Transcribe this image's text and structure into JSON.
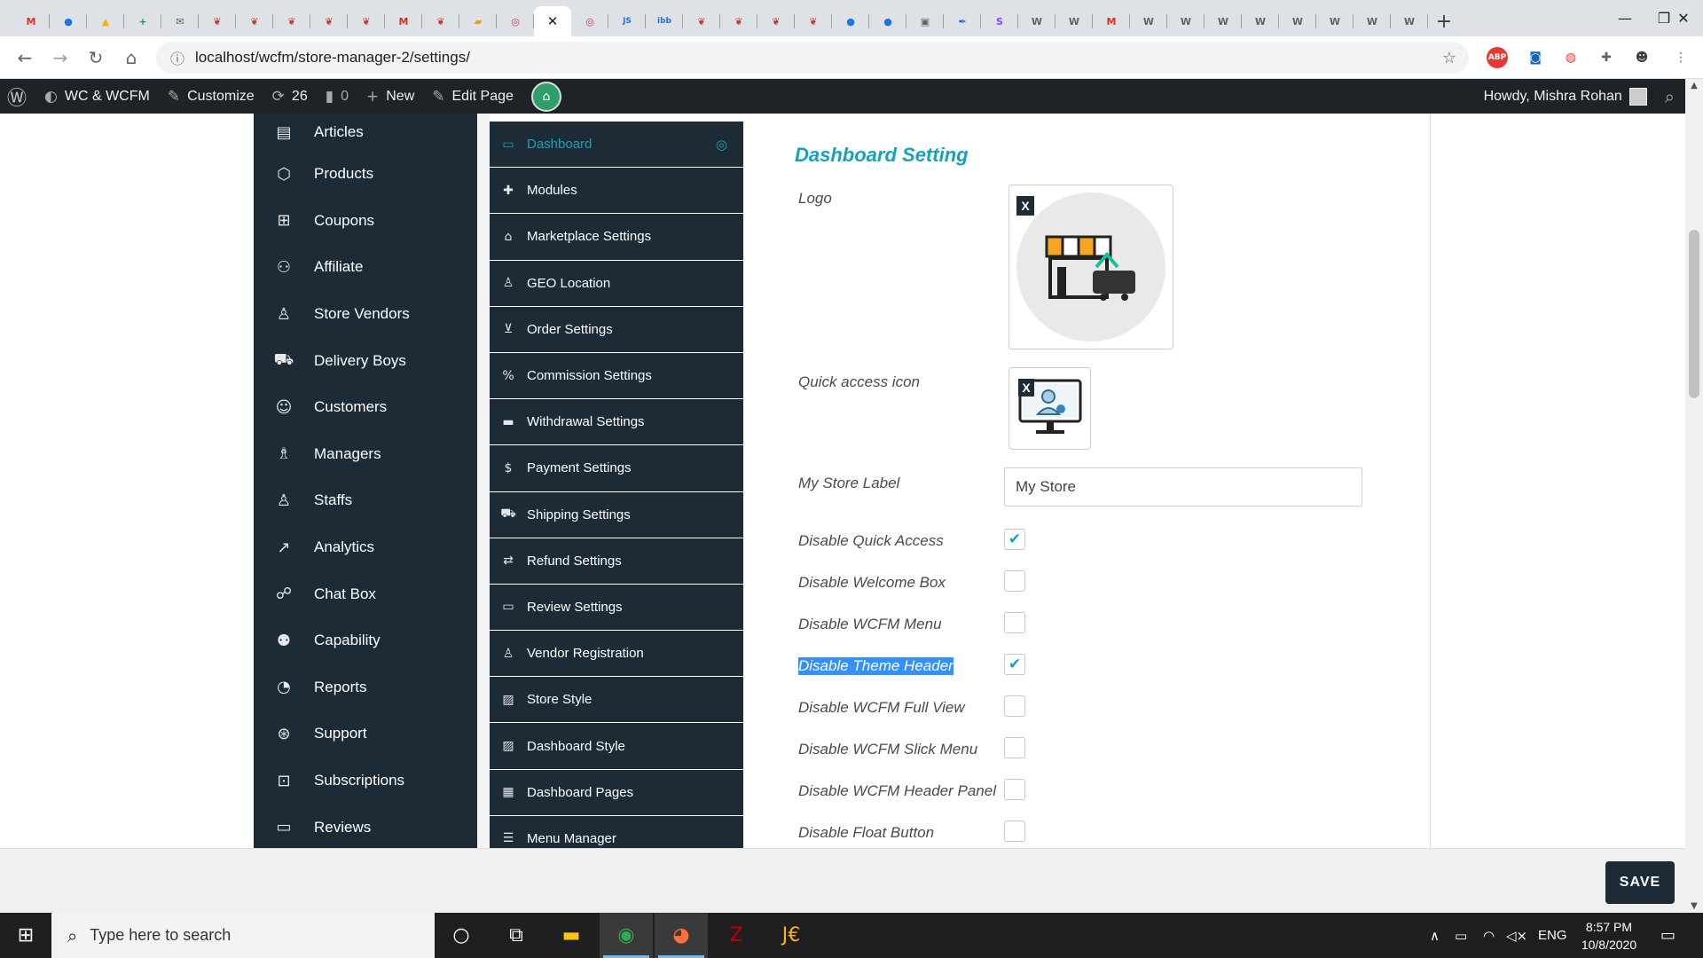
{
  "browser": {
    "tabs": [
      {
        "icon": "gmail-icon",
        "glyph": "M",
        "color": "#d93025"
      },
      {
        "icon": "globe-icon",
        "glyph": "●",
        "color": "#1a73e8"
      },
      {
        "icon": "google-drive-icon",
        "glyph": "▲",
        "color": "#f4b400"
      },
      {
        "icon": "sheets-icon",
        "glyph": "+",
        "color": "#0f9d58"
      },
      {
        "icon": "mail-icon",
        "glyph": "✉",
        "color": "#5f6368"
      },
      {
        "icon": "leaf-icon",
        "glyph": "❦",
        "color": "#c0392b"
      },
      {
        "icon": "leaf-icon",
        "glyph": "❦",
        "color": "#c0392b"
      },
      {
        "icon": "leaf-icon",
        "glyph": "❦",
        "color": "#c0392b"
      },
      {
        "icon": "leaf-icon",
        "glyph": "❦",
        "color": "#c0392b"
      },
      {
        "icon": "leaf-icon",
        "glyph": "❦",
        "color": "#c0392b"
      },
      {
        "icon": "gmail-icon",
        "glyph": "M",
        "color": "#d93025"
      },
      {
        "icon": "leaf-icon",
        "glyph": "❦",
        "color": "#c0392b"
      },
      {
        "icon": "pma-icon",
        "glyph": "▰",
        "color": "#f39c12"
      },
      {
        "icon": "instagram-icon",
        "glyph": "◎",
        "color": "#e1306c"
      },
      {
        "icon": "close-icon",
        "glyph": "✕",
        "color": "#202124",
        "active": true
      },
      {
        "icon": "instagram-icon",
        "glyph": "◎",
        "color": "#e1306c"
      },
      {
        "icon": "js-icon",
        "glyph": "JS",
        "color": "#1a73e8"
      },
      {
        "icon": "imgbb-icon",
        "glyph": "ibb",
        "color": "#1a73e8"
      },
      {
        "icon": "leaf-icon",
        "glyph": "❦",
        "color": "#c0392b"
      },
      {
        "icon": "leaf-icon",
        "glyph": "❦",
        "color": "#c0392b"
      },
      {
        "icon": "leaf-icon",
        "glyph": "❦",
        "color": "#c0392b"
      },
      {
        "icon": "leaf-icon",
        "glyph": "❦",
        "color": "#c0392b"
      },
      {
        "icon": "globe-icon",
        "glyph": "●",
        "color": "#1a73e8"
      },
      {
        "icon": "globe-icon",
        "glyph": "●",
        "color": "#1a73e8"
      },
      {
        "icon": "monitor-icon",
        "glyph": "▣",
        "color": "#5f6368"
      },
      {
        "icon": "feather-icon",
        "glyph": "✒",
        "color": "#1a73e8"
      },
      {
        "icon": "s-icon",
        "glyph": "S",
        "color": "#7c4dff"
      },
      {
        "icon": "wordpress-icon",
        "glyph": "W",
        "color": "#5f6368"
      },
      {
        "icon": "wordpress-icon",
        "glyph": "W",
        "color": "#5f6368"
      },
      {
        "icon": "gmail-icon",
        "glyph": "M",
        "color": "#d93025"
      },
      {
        "icon": "wordpress-icon",
        "glyph": "W",
        "color": "#5f6368"
      },
      {
        "icon": "wordpress-icon",
        "glyph": "W",
        "color": "#5f6368"
      },
      {
        "icon": "wordpress-icon",
        "glyph": "W",
        "color": "#5f6368"
      },
      {
        "icon": "wordpress-icon",
        "glyph": "W",
        "color": "#5f6368"
      },
      {
        "icon": "wordpress-icon",
        "glyph": "W",
        "color": "#5f6368"
      },
      {
        "icon": "wordpress-icon",
        "glyph": "W",
        "color": "#5f6368"
      },
      {
        "icon": "wordpress-icon",
        "glyph": "W",
        "color": "#5f6368"
      },
      {
        "icon": "wordpress-icon",
        "glyph": "W",
        "color": "#5f6368"
      }
    ],
    "new_tab_glyph": "+",
    "url": "localhost/wcfm/store-manager-2/settings/",
    "info_glyph": "ⓘ",
    "star_glyph": "☆",
    "back_glyph": "←",
    "forward_glyph": "→",
    "reload_glyph": "↻",
    "home_glyph": "⌂",
    "minimize_glyph": "—",
    "maximize_glyph": "❐",
    "close_glyph": "✕",
    "extensions": [
      {
        "name": "adblock-icon",
        "glyph": "ABP",
        "color": "#e53935"
      },
      {
        "name": "screenshot-icon",
        "glyph": "◙",
        "color": "#1565c0"
      },
      {
        "name": "swirl-icon",
        "glyph": "◍",
        "color": "#e53935"
      },
      {
        "name": "puzzle-icon",
        "glyph": "✚",
        "color": "#5f6368"
      },
      {
        "name": "profile-avatar-icon",
        "glyph": "☻",
        "color": "#3c4043"
      },
      {
        "name": "menu-dots-icon",
        "glyph": "⋮",
        "color": "#5f6368"
      }
    ]
  },
  "adminbar": {
    "wp_glyph": "Ⓦ",
    "site": "WC & WCFM",
    "customize": "Customize",
    "updates": "26",
    "comments": "0",
    "new": "New",
    "edit_page": "Edit Page",
    "howdy": "Howdy, Mishra Rohan",
    "search_glyph": "⌕"
  },
  "main_menu": [
    {
      "label": "Articles",
      "icon": "article-icon",
      "glyph": "▤"
    },
    {
      "label": "Products",
      "icon": "cube-icon",
      "glyph": "⬡"
    },
    {
      "label": "Coupons",
      "icon": "gift-icon",
      "glyph": "⊞"
    },
    {
      "label": "Affiliate",
      "icon": "users-icon",
      "glyph": "⚇"
    },
    {
      "label": "Store Vendors",
      "icon": "user-icon",
      "glyph": "♙"
    },
    {
      "label": "Delivery Boys",
      "icon": "truck-icon",
      "glyph": "⛟"
    },
    {
      "label": "Customers",
      "icon": "user-circle-icon",
      "glyph": "☺"
    },
    {
      "label": "Managers",
      "icon": "user-tie-icon",
      "glyph": "♗"
    },
    {
      "label": "Staffs",
      "icon": "user-icon",
      "glyph": "♙"
    },
    {
      "label": "Analytics",
      "icon": "chart-line-icon",
      "glyph": "↗"
    },
    {
      "label": "Chat Box",
      "icon": "comments-icon",
      "glyph": "☍"
    },
    {
      "label": "Capability",
      "icon": "user-times-icon",
      "glyph": "⚉"
    },
    {
      "label": "Reports",
      "icon": "chart-pie-icon",
      "glyph": "◔"
    },
    {
      "label": "Support",
      "icon": "life-ring-icon",
      "glyph": "⊛"
    },
    {
      "label": "Subscriptions",
      "icon": "money-bill-icon",
      "glyph": "⊡"
    },
    {
      "label": "Reviews",
      "icon": "comment-icon",
      "glyph": "▭"
    }
  ],
  "settings_menu": [
    {
      "label": "Dashboard",
      "icon": "desktop-icon",
      "glyph": "▭",
      "active": true,
      "indicator": "◎"
    },
    {
      "label": "Modules",
      "icon": "puzzle-icon",
      "glyph": "✚"
    },
    {
      "label": "Marketplace Settings",
      "icon": "home-icon",
      "glyph": "⌂"
    },
    {
      "label": "GEO Location",
      "icon": "street-view-icon",
      "glyph": "♙"
    },
    {
      "label": "Order Settings",
      "icon": "cart-icon",
      "glyph": "⊻"
    },
    {
      "label": "Commission Settings",
      "icon": "percent-icon",
      "glyph": "%"
    },
    {
      "label": "Withdrawal Settings",
      "icon": "credit-card-icon",
      "glyph": "▬"
    },
    {
      "label": "Payment Settings",
      "icon": "dollar-icon",
      "glyph": "$"
    },
    {
      "label": "Shipping Settings",
      "icon": "truck-icon",
      "glyph": "⛟"
    },
    {
      "label": "Refund Settings",
      "icon": "retweet-icon",
      "glyph": "⇄"
    },
    {
      "label": "Review Settings",
      "icon": "comment-icon",
      "glyph": "▭"
    },
    {
      "label": "Vendor Registration",
      "icon": "user-icon",
      "glyph": "♙"
    },
    {
      "label": "Store Style",
      "icon": "image-icon",
      "glyph": "▨"
    },
    {
      "label": "Dashboard Style",
      "icon": "image-icon",
      "glyph": "▨"
    },
    {
      "label": "Dashboard Pages",
      "icon": "newspaper-icon",
      "glyph": "▦"
    },
    {
      "label": "Menu Manager",
      "icon": "list-icon",
      "glyph": "☰"
    }
  ],
  "form": {
    "title": "Dashboard Setting",
    "logo_label": "Logo",
    "quick_access_label": "Quick access icon",
    "remove_glyph": "X",
    "store_label": "My Store Label",
    "store_value": "My Store",
    "check_glyph": "✔",
    "checkboxes": [
      {
        "label": "Disable Quick Access",
        "checked": true
      },
      {
        "label": "Disable Welcome Box",
        "checked": false
      },
      {
        "label": "Disable WCFM Menu",
        "checked": false
      },
      {
        "label": "Disable Theme Header",
        "checked": true,
        "selected": true
      },
      {
        "label": "Disable WCFM Full View",
        "checked": false
      },
      {
        "label": "Disable WCFM Slick Menu",
        "checked": false
      },
      {
        "label": "Disable WCFM Header Panel",
        "checked": false
      },
      {
        "label": "Disable Float Button",
        "checked": false
      }
    ]
  },
  "save_label": "SAVE",
  "taskbar": {
    "start_glyph": "⊞",
    "search_glyph": "⌕",
    "search_placeholder": "Type here to search",
    "apps": [
      {
        "name": "cortana-icon",
        "glyph": "○",
        "color": "#ffffff"
      },
      {
        "name": "task-view-icon",
        "glyph": "⧉",
        "color": "#ffffff"
      },
      {
        "name": "file-explorer-icon",
        "glyph": "▬",
        "color": "#f9c513"
      },
      {
        "name": "chrome-icon",
        "glyph": "◉",
        "color": "#34a853",
        "running": true
      },
      {
        "name": "firefox-icon",
        "glyph": "◕",
        "color": "#ff7139",
        "running": true
      },
      {
        "name": "filezilla-icon",
        "glyph": "Z",
        "color": "#bf0000"
      },
      {
        "name": "jetbrains-icon",
        "glyph": "J€",
        "color": "#fcb317"
      }
    ],
    "tray": {
      "chevron": "∧",
      "battery": "▭",
      "wifi": "◠",
      "volume": "◁×",
      "lang": "ENG",
      "notif": "▭"
    },
    "time": "8:57 PM",
    "date": "10/8/2020"
  }
}
